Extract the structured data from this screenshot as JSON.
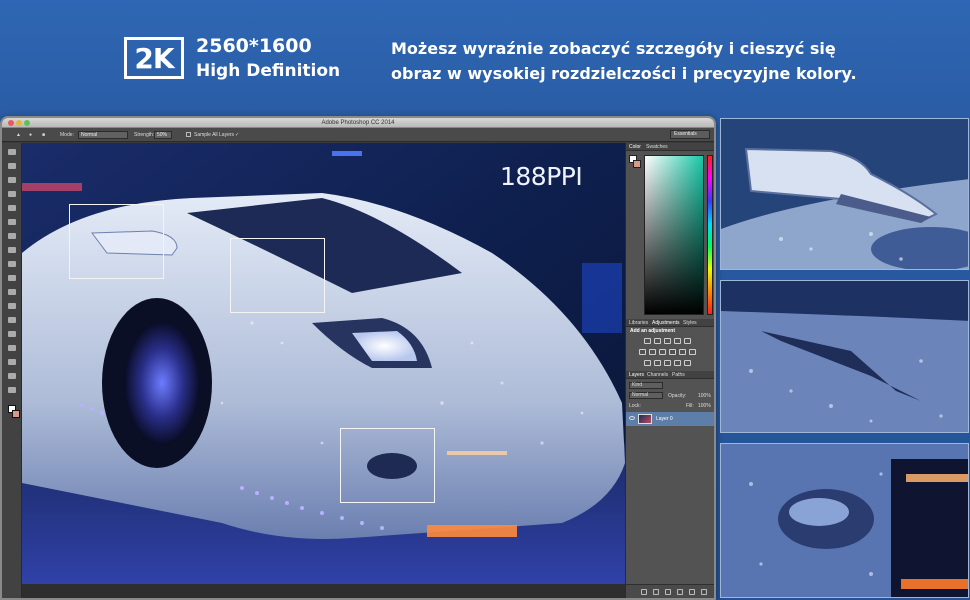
{
  "banner": {
    "badge": "2K",
    "resolution": "2560*1600",
    "definition": "High Definition",
    "tagline_line1": "Możesz wyraźnie zobaczyć szczegóły i cieszyć się",
    "tagline_line2": "obraz w wysokiej rozdzielczości i precyzyjne kolory."
  },
  "window": {
    "title": "Adobe Photoshop CC 2014"
  },
  "options_bar": {
    "mode_label": "Mode:",
    "mode_value": "Normal",
    "strength_label": "Strength:",
    "strength_value": "50%",
    "sample_all_layers": "Sample All Layers",
    "workspace": "Essentials"
  },
  "canvas": {
    "ppi_label": "188PPI"
  },
  "panels": {
    "color_tabs": [
      "Color",
      "Swatches"
    ],
    "adjust_tabs": [
      "Libraries",
      "Adjustments",
      "Styles"
    ],
    "adjust_title": "Add an adjustment",
    "layers_tabs": [
      "Layers",
      "Channels",
      "Paths"
    ],
    "kind_label": "Kind",
    "blend_mode": "Normal",
    "opacity_label": "Opacity:",
    "opacity_value": "100%",
    "lock_label": "Lock:",
    "fill_label": "Fill:",
    "fill_value": "100%",
    "layer_name": "Layer 0"
  },
  "icons": [
    "apple-traffic-lights",
    "brush-tool-icon",
    "eye-icon",
    "layer-thumbnail",
    "adjustment-icons"
  ],
  "colors": {
    "background": "#2a5da6",
    "car_body": "#cfd8ea",
    "neon_blue": "#3a5cff",
    "accent_orange": "#ff8a3d"
  }
}
